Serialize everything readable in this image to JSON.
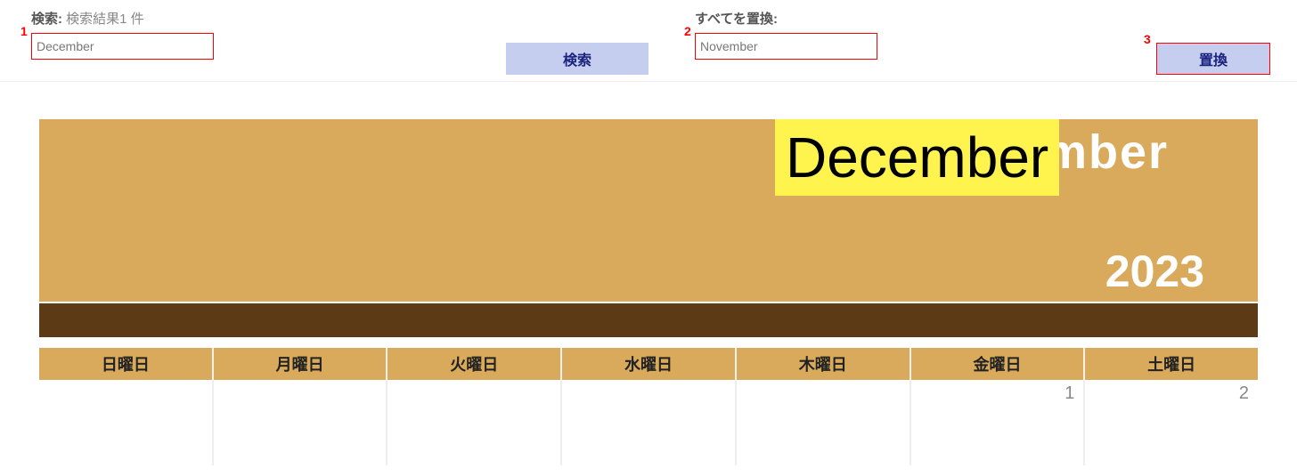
{
  "toolbar": {
    "search_label": "検索:",
    "search_result_text": "検索結果1 件",
    "search_value": "December",
    "search_button": "検索",
    "replace_label": "すべてを置換:",
    "replace_value": "November",
    "replace_button": "置換"
  },
  "callouts": {
    "one": "1",
    "two": "2",
    "three": "3"
  },
  "highlight": {
    "text": "December"
  },
  "calendar": {
    "month": "December",
    "year": "2023",
    "days": [
      "日曜日",
      "月曜日",
      "火曜日",
      "水曜日",
      "木曜日",
      "金曜日",
      "土曜日"
    ],
    "first_row_numbers": [
      "",
      "",
      "",
      "",
      "",
      "1",
      "2"
    ]
  }
}
